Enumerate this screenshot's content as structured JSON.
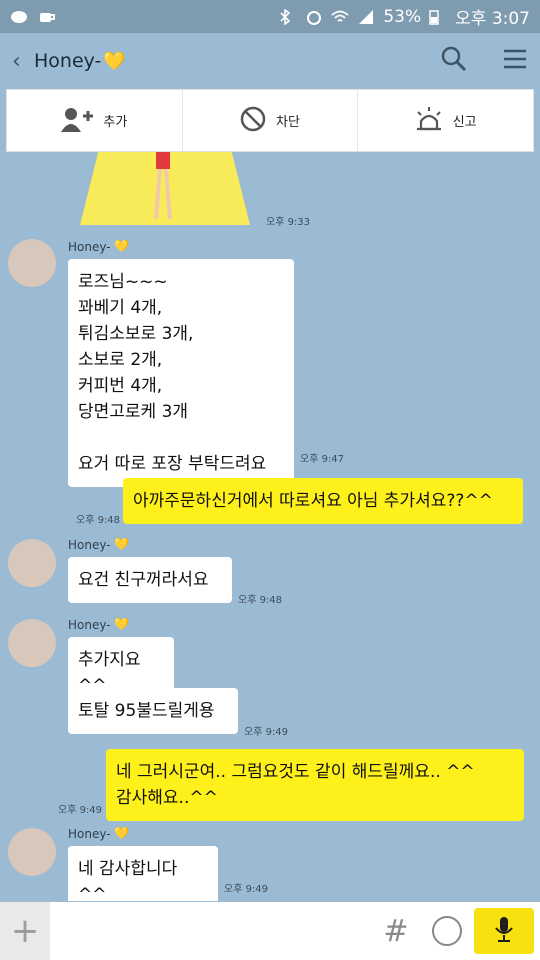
{
  "status_bar": {
    "battery": "53%",
    "time": "오후 3:07"
  },
  "header": {
    "title": "Honey-",
    "heart": "💛"
  },
  "action_bar": {
    "add": "추가",
    "block": "차단",
    "report": "신고"
  },
  "messages": [
    {
      "id": "img",
      "time": "오후 9:33"
    },
    {
      "id": "m1",
      "sender": "Honey-",
      "text": "로즈님~~~\n꽈베기 4개,\n튀김소보로 3개,\n소보로 2개,\n커피번 4개,\n당면고로케 3개\n\n요거 따로 포장 부탁드려요",
      "time": "오후 9:47"
    },
    {
      "id": "m2",
      "mine": true,
      "text": "아까주문하신거에서 따로셔요 아님 추가셔요??^^",
      "time": "오후 9:48"
    },
    {
      "id": "m3",
      "sender": "Honey-",
      "text": "요건 친구꺼라서요",
      "time": "오후 9:48"
    },
    {
      "id": "m4",
      "sender": "Honey-",
      "text": "추가지요^^",
      "time": ""
    },
    {
      "id": "m5",
      "text": "토탈 95불드릴게용",
      "time": "오후 9:49"
    },
    {
      "id": "m6",
      "mine": true,
      "text": "네 그러시군여.. 그럼요것도 같이 해드릴께요.. ^^\n감사해요..^^",
      "time": "오후 9:49"
    },
    {
      "id": "m7",
      "sender": "Honey-",
      "text": "네 감사합니다 ^^",
      "time": "오후 9:49"
    }
  ],
  "composer": {
    "hash": "#"
  }
}
